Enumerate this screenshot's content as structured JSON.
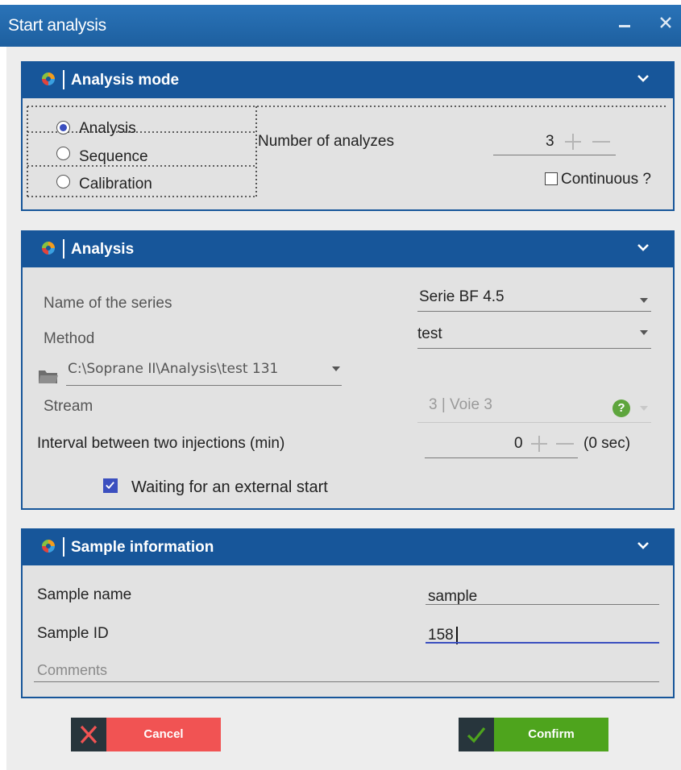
{
  "window": {
    "title": "Start analysis",
    "minimize_glyph": "‗",
    "close_glyph": "✕"
  },
  "panels": {
    "mode": {
      "title": "Analysis mode",
      "options": [
        "Analysis",
        "Sequence",
        "Calibration"
      ],
      "selected": "Analysis",
      "number_label": "Number of analyzes",
      "number_value": "3",
      "continuous_label": "Continuous ?",
      "continuous_checked": false
    },
    "analysis": {
      "title": "Analysis",
      "series_label": "Name of the series",
      "series_value": "Serie BF 4.5",
      "method_label": "Method",
      "method_value": "test",
      "path_value": "C:\\Soprane II\\Analysis\\test 131",
      "stream_label": "Stream",
      "stream_value": "3 | Voie 3",
      "stream_help": "?",
      "interval_label": "Interval between two injections (min)",
      "interval_value": "0",
      "interval_seconds": "(0 sec)",
      "external_start_label": "Waiting for an external start",
      "external_start_checked": true
    },
    "sample": {
      "title": "Sample information",
      "name_label": "Sample name",
      "name_value": "sample",
      "id_label": "Sample ID",
      "id_value": "158",
      "comments_placeholder": "Comments"
    }
  },
  "buttons": {
    "cancel": "Cancel",
    "confirm": "Confirm"
  },
  "colors": {
    "header_blue": "#17569a",
    "cancel_red": "#f15353",
    "confirm_green": "#4ea41d",
    "accent_radio": "#3b4fbf"
  }
}
